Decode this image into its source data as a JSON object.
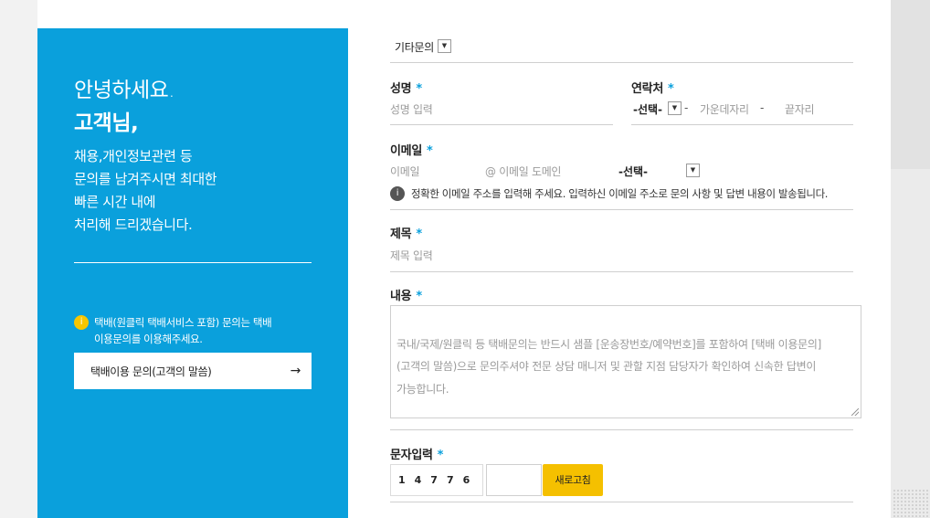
{
  "promo": {
    "greeting_line1": "안녕하세요.",
    "greeting_line2": "고객님,",
    "description": "채용,개인정보관련 등\n문의를 남겨주시면 최대한\n빠른 시간 내에\n처리해 드리겠습니다.",
    "notice_icon": "i",
    "notice_text": "택배(원클릭 택배서비스 포함) 문의는 택배\n이용문의를 이용해주세요.",
    "cs_button_label": "택배이용 문의(고객의 말씀)",
    "cs_button_arrow": "→"
  },
  "form": {
    "category": {
      "value": "기타문의",
      "arrow": "▼"
    },
    "name": {
      "label": "성명",
      "required": "*",
      "placeholder": "성명 입력"
    },
    "contact": {
      "label": "연락처",
      "required": "*",
      "select_value": "-선택-",
      "select_arrow": "▼",
      "dash1": "-",
      "middle_placeholder": "가운데자리",
      "dash2": "-",
      "last_placeholder": "끝자리"
    },
    "email": {
      "label": "이메일",
      "required": "*",
      "id_placeholder": "이메일",
      "domain_placeholder": "@ 이메일 도메인",
      "select_value": "-선택-",
      "select_arrow": "▼",
      "info_icon": "i",
      "info_text": "정확한 이메일 주소를 입력해 주세요. 입력하신 이메일 주소로 문의 사항 및 답변 내용이 발송됩니다."
    },
    "subject": {
      "label": "제목",
      "required": "*",
      "placeholder": "제목 입력"
    },
    "content": {
      "label": "내용",
      "required": "*",
      "placeholder": "국내/국제/원클릭 등 택배문의는 반드시 샘플 [운송장번호/예약번호]를 포함하여 [택배 이용문의]\n(고객의 말씀)으로 문의주셔야 전문 상담 매니저 및 관할 지점 담당자가 확인하여 신속한 답변이\n가능합니다."
    },
    "captcha": {
      "label": "문자입력",
      "required": "*",
      "code": "14776",
      "refresh_label": "새로고침"
    }
  }
}
